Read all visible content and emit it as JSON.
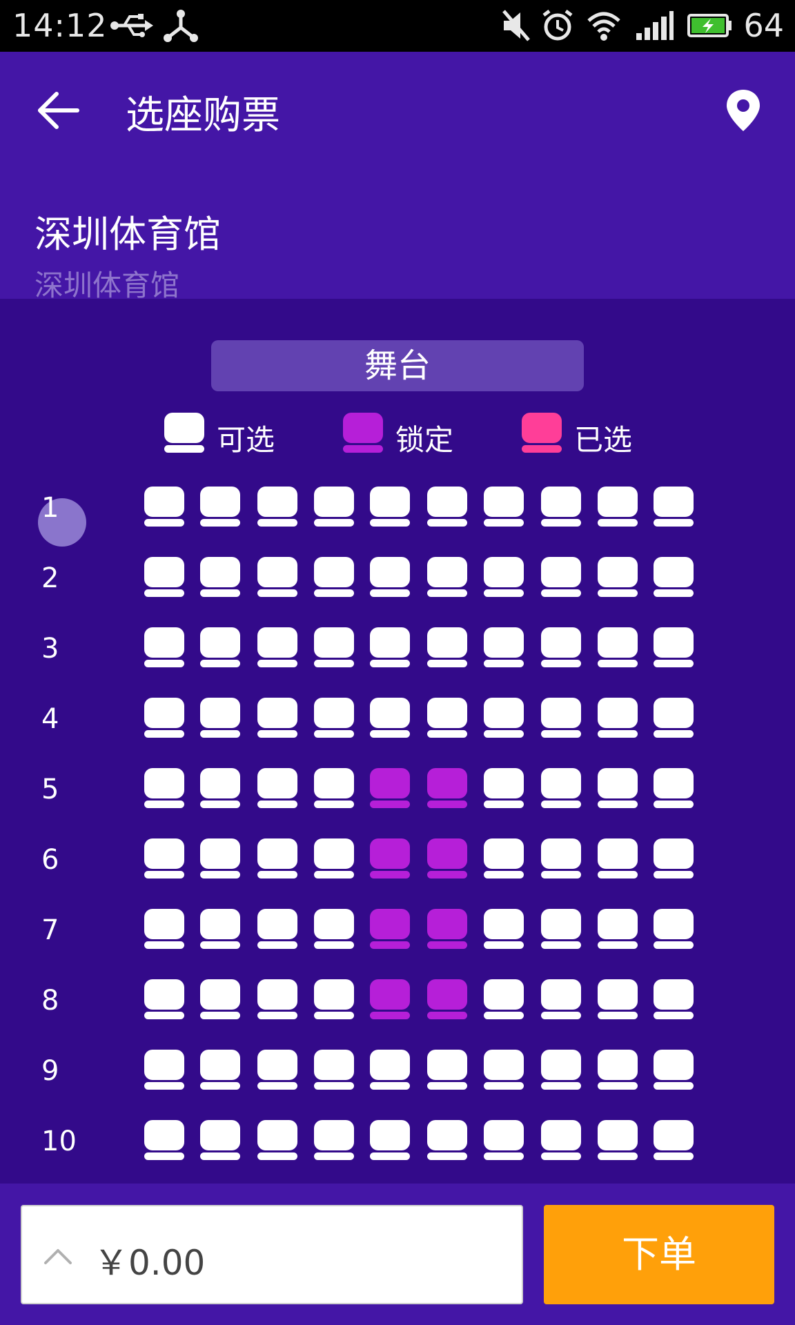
{
  "status_bar": {
    "time": "14:12",
    "battery_level": "64",
    "icons": [
      "usb-icon",
      "share-icon",
      "mute-icon",
      "alarm-icon",
      "wifi-icon",
      "signal-icon",
      "battery-icon"
    ]
  },
  "header": {
    "title": "选座购票",
    "venue_name": "深圳体育馆",
    "venue_subtitle": "深圳体育馆",
    "back_icon": "arrow-left-icon",
    "location_icon": "map-pin-icon"
  },
  "stage": {
    "label": "舞台"
  },
  "legend": [
    {
      "label": "可选",
      "status": "available",
      "color": "#ffffff"
    },
    {
      "label": "锁定",
      "status": "locked",
      "color": "#b61fd8"
    },
    {
      "label": "已选",
      "status": "selected",
      "color": "#ff3e98"
    }
  ],
  "rows": [
    {
      "label": "1",
      "seats": [
        "a",
        "a",
        "a",
        "a",
        "a",
        "a",
        "a",
        "a",
        "a",
        "a"
      ]
    },
    {
      "label": "2",
      "seats": [
        "a",
        "a",
        "a",
        "a",
        "a",
        "a",
        "a",
        "a",
        "a",
        "a"
      ]
    },
    {
      "label": "3",
      "seats": [
        "a",
        "a",
        "a",
        "a",
        "a",
        "a",
        "a",
        "a",
        "a",
        "a"
      ]
    },
    {
      "label": "4",
      "seats": [
        "a",
        "a",
        "a",
        "a",
        "a",
        "a",
        "a",
        "a",
        "a",
        "a"
      ]
    },
    {
      "label": "5",
      "seats": [
        "a",
        "a",
        "a",
        "a",
        "l",
        "l",
        "a",
        "a",
        "a",
        "a"
      ]
    },
    {
      "label": "6",
      "seats": [
        "a",
        "a",
        "a",
        "a",
        "l",
        "l",
        "a",
        "a",
        "a",
        "a"
      ]
    },
    {
      "label": "7",
      "seats": [
        "a",
        "a",
        "a",
        "a",
        "l",
        "l",
        "a",
        "a",
        "a",
        "a"
      ]
    },
    {
      "label": "8",
      "seats": [
        "a",
        "a",
        "a",
        "a",
        "l",
        "l",
        "a",
        "a",
        "a",
        "a"
      ]
    },
    {
      "label": "9",
      "seats": [
        "a",
        "a",
        "a",
        "a",
        "a",
        "a",
        "a",
        "a",
        "a",
        "a"
      ]
    },
    {
      "label": "10",
      "seats": [
        "a",
        "a",
        "a",
        "a",
        "a",
        "a",
        "a",
        "a",
        "a",
        "a"
      ]
    }
  ],
  "bottom": {
    "price": "￥0.00",
    "order_label": "下单",
    "expand_icon": "chevron-up-icon"
  },
  "colors": {
    "header_bg": "#4416a6",
    "seat_area_bg": "#330a8a",
    "order_button": "#ffa00a"
  }
}
